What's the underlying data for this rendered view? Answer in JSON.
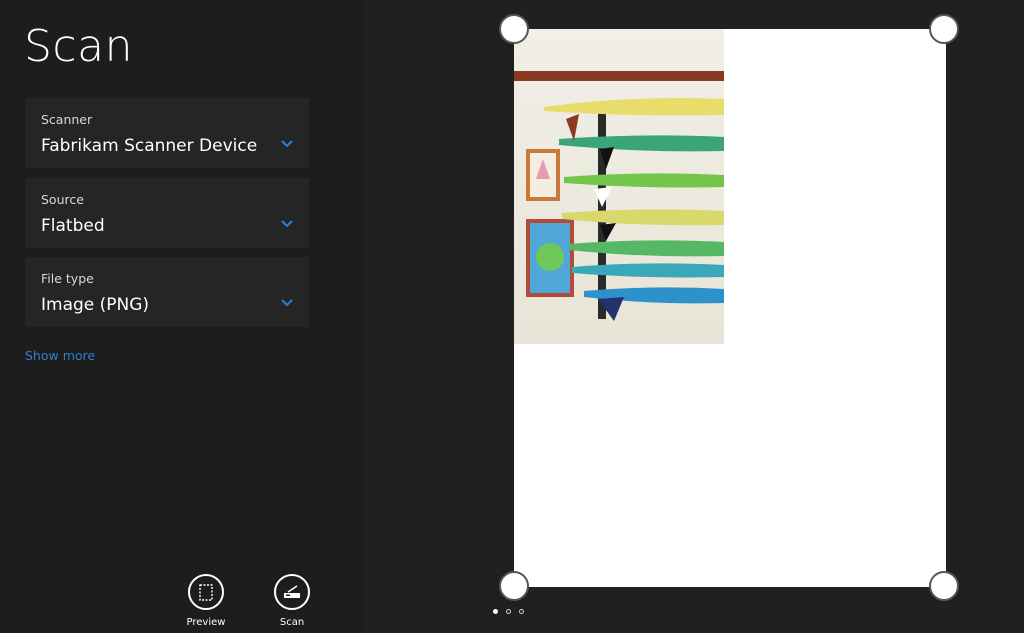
{
  "app": {
    "title": "Scan"
  },
  "fields": [
    {
      "label": "Scanner",
      "value": "Fabrikam Scanner Device"
    },
    {
      "label": "Source",
      "value": "Flatbed"
    },
    {
      "label": "File type",
      "value": "Image (PNG)"
    }
  ],
  "show_more": "Show more",
  "appbar": {
    "preview_label": "Preview",
    "scan_label": "Scan"
  },
  "preview": {
    "page_count": 3,
    "current_page": 1,
    "image_description": "surfboards-rack-photo"
  },
  "colors": {
    "accent": "#2d7fd1",
    "background": "#1d1d1d",
    "field_bg": "#252525",
    "page": "#ffffff"
  },
  "icons": [
    "chevron-down-icon",
    "preview-icon",
    "scanner-icon"
  ]
}
